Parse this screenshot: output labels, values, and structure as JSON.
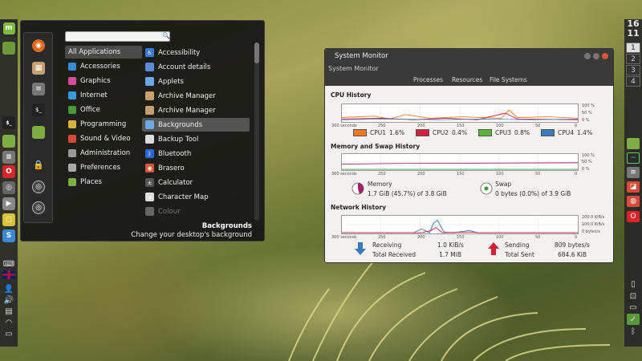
{
  "clock": {
    "hours": "16",
    "minutes": "11"
  },
  "workspaces": [
    "1",
    "2",
    "3",
    "4"
  ],
  "left_panel": {
    "mint_glyph": "m",
    "items": [
      {
        "name": "folder-icon",
        "glyph": "",
        "color": "#6a9a3a"
      },
      {
        "name": "terminal-icon",
        "glyph": "$_",
        "color": "#222222"
      },
      {
        "name": "files-icon",
        "glyph": "",
        "color": "#7fae43"
      },
      {
        "name": "settings-icon",
        "glyph": "≡",
        "color": "#777777"
      },
      {
        "name": "opera-icon",
        "glyph": "O",
        "color": "#d9242b"
      },
      {
        "name": "tool-icon",
        "glyph": "◎",
        "color": "#666666"
      },
      {
        "name": "media-icon",
        "glyph": "▶",
        "color": "#888888"
      },
      {
        "name": "notes-icon",
        "glyph": "◻",
        "color": "#d8c23a"
      },
      {
        "name": "store-icon",
        "glyph": "S",
        "color": "#3a8ad8"
      }
    ]
  },
  "menu": {
    "search_placeholder": "",
    "categories": [
      {
        "label": "All Applications",
        "color": ""
      },
      {
        "label": "Accessories",
        "color": "#3a8ad8"
      },
      {
        "label": "Graphics",
        "color": "#d84a9a"
      },
      {
        "label": "Internet",
        "color": "#3a9ad8"
      },
      {
        "label": "Office",
        "color": "#4a9a3a"
      },
      {
        "label": "Programming",
        "color": "#d8b23a"
      },
      {
        "label": "Sound & Video",
        "color": "#d8483a"
      },
      {
        "label": "Administration",
        "color": "#999999"
      },
      {
        "label": "Preferences",
        "color": "#aaaaaa"
      },
      {
        "label": "Places",
        "color": "#7fae43"
      }
    ],
    "apps": [
      {
        "label": "Accessibility",
        "color": "#3a7ad8",
        "glyph": "♿"
      },
      {
        "label": "Account details",
        "color": "#5a8ad8",
        "glyph": ""
      },
      {
        "label": "Applets",
        "color": "#6aa8e8",
        "glyph": ""
      },
      {
        "label": "Archive Manager",
        "color": "#c8a070",
        "glyph": ""
      },
      {
        "label": "Archive Manager",
        "color": "#c8a070",
        "glyph": ""
      },
      {
        "label": "Backgrounds",
        "color": "#6aa8e8",
        "glyph": ""
      },
      {
        "label": "Backup Tool",
        "color": "#dddddd",
        "glyph": ""
      },
      {
        "label": "Bluetooth",
        "color": "#2a6ad8",
        "glyph": "ᛒ"
      },
      {
        "label": "Brasero",
        "color": "#d8583a",
        "glyph": "◉"
      },
      {
        "label": "Calculator",
        "color": "#555555",
        "glyph": "±"
      },
      {
        "label": "Character Map",
        "color": "#dddddd",
        "glyph": "a"
      },
      {
        "label": "Colour",
        "color": "#666666",
        "glyph": ""
      }
    ],
    "description_title": "Backgrounds",
    "description_text": "Change your desktop's background"
  },
  "sysmon": {
    "title": "System Monitor",
    "menu_label": "System Monitor",
    "tabs": [
      "Processes",
      "Resources",
      "File Systems"
    ],
    "cpu_title": "CPU History",
    "mem_title": "Memory and Swap History",
    "net_title": "Network History",
    "cpu_y_ticks": [
      "100 %",
      "50 %",
      "0 %"
    ],
    "mem_y_ticks": [
      "100 %",
      "50 %",
      "0 %"
    ],
    "net_y_ticks": [
      "200.0 KiB/s",
      "100.0 KiB/s",
      "0 bytes/s"
    ],
    "x_ticks": [
      "300 seconds",
      "250",
      "200",
      "150",
      "100",
      "50",
      "0"
    ],
    "cpus": [
      {
        "label": "CPU1",
        "value": "1.6%",
        "color": "#f07a20"
      },
      {
        "label": "CPU2",
        "value": "0.4%",
        "color": "#d0203a"
      },
      {
        "label": "CPU3",
        "value": "0.8%",
        "color": "#5ab43a"
      },
      {
        "label": "CPU4",
        "value": "1.4%",
        "color": "#3a7ab8"
      }
    ],
    "memory_label": "Memory",
    "memory_value": "1.7 GiB (45.7%) of 3.8 GiB",
    "swap_label": "Swap",
    "swap_value": "0 bytes (0.0%) of 3.9 GiB",
    "receiving_label": "Receiving",
    "receiving_value": "1.0 KiB/s",
    "total_received_label": "Total Received",
    "total_received_value": "1.7 MiB",
    "sending_label": "Sending",
    "sending_value": "809 bytes/s",
    "total_sent_label": "Total Sent",
    "total_sent_value": "684.6 KiB",
    "memory_percent": 45.7,
    "swap_percent": 0.0,
    "colors": {
      "memory": "#a0206a",
      "swap": "#3a9a3a",
      "receive": "#3a7ab8",
      "send": "#d0203a"
    }
  },
  "right_panel": {
    "items": [
      {
        "name": "folder-icon",
        "glyph": "",
        "color": "#7fae43"
      },
      {
        "name": "system-monitor-icon",
        "glyph": "~",
        "color": "#2a2a2a"
      },
      {
        "name": "settings-icon",
        "glyph": "≡",
        "color": "#777777"
      },
      {
        "name": "photos-icon",
        "glyph": "◪",
        "color": "#d84a3a"
      },
      {
        "name": "ubuntu-software-icon",
        "glyph": "◍",
        "color": "#d84a3a"
      },
      {
        "name": "opera-icon",
        "glyph": "O",
        "color": "#d9242b"
      }
    ],
    "tray": [
      {
        "name": "trash-icon",
        "glyph": "▯"
      },
      {
        "name": "removable-drive-icon",
        "glyph": "⊡"
      },
      {
        "name": "display-icon",
        "glyph": "▭"
      },
      {
        "name": "shield-icon",
        "glyph": "✓"
      },
      {
        "name": "bluetooth-icon",
        "glyph": "ᛒ"
      }
    ]
  },
  "left_tray": [
    {
      "name": "keyboard-icon",
      "glyph": "⌨"
    },
    {
      "name": "uk-flag-icon",
      "glyph": ""
    },
    {
      "name": "user-icon",
      "glyph": "👤"
    },
    {
      "name": "volume-icon",
      "glyph": "🔊"
    },
    {
      "name": "clipboard-icon",
      "glyph": "▤"
    },
    {
      "name": "wifi-icon",
      "glyph": "◠"
    },
    {
      "name": "display-icon",
      "glyph": "▭"
    }
  ]
}
